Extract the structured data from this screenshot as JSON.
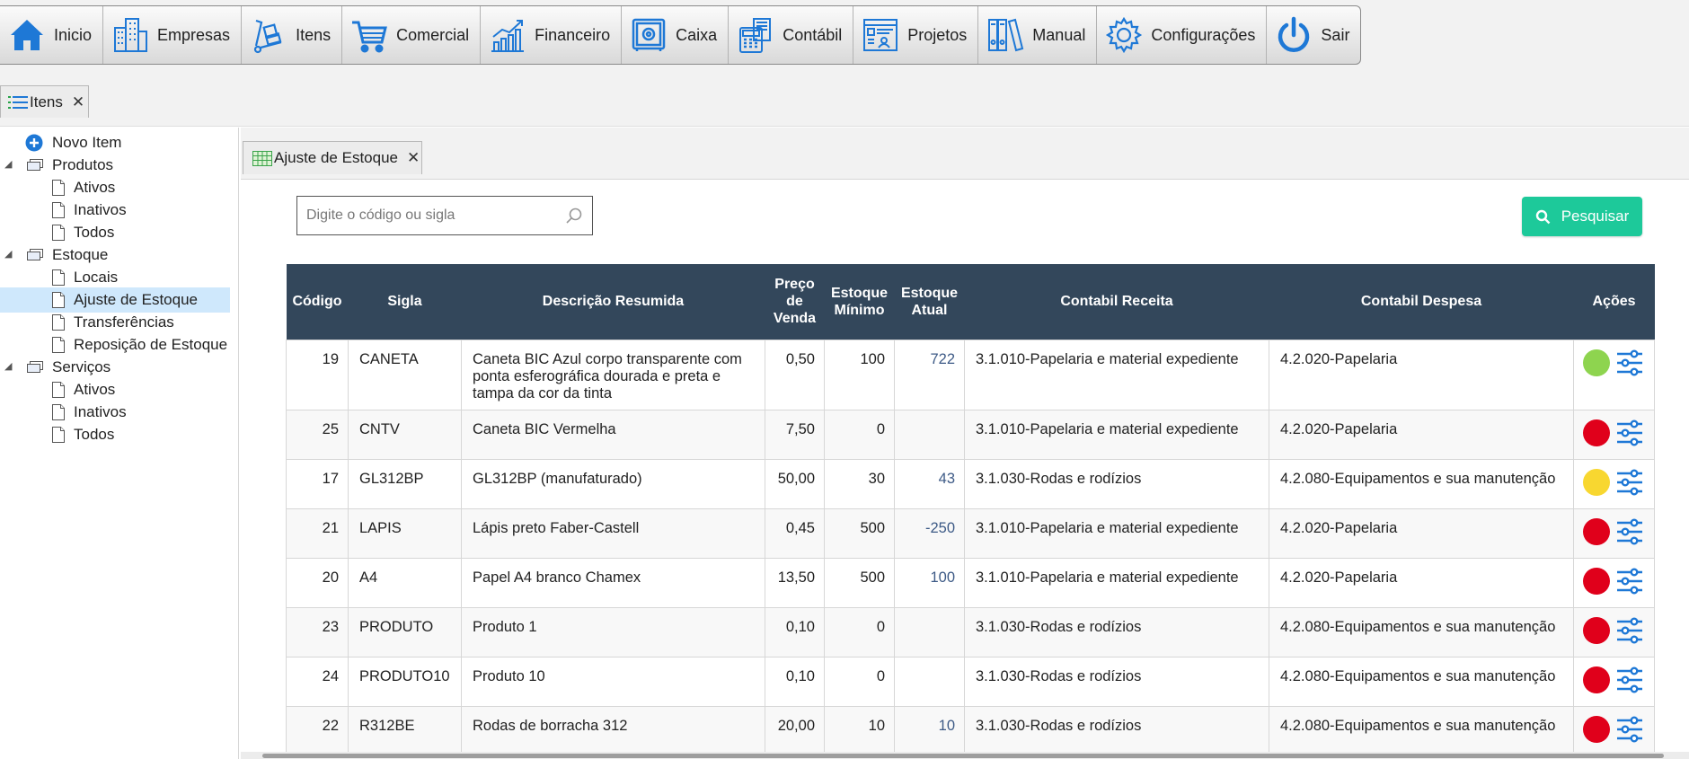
{
  "menu": [
    {
      "label": "Inicio",
      "icon": "home-icon"
    },
    {
      "label": "Empresas",
      "icon": "buildings-icon"
    },
    {
      "label": "Itens",
      "icon": "hand-truck-icon"
    },
    {
      "label": "Comercial",
      "icon": "shopping-cart-icon"
    },
    {
      "label": "Financeiro",
      "icon": "growth-chart-icon"
    },
    {
      "label": "Caixa",
      "icon": "safe-icon"
    },
    {
      "label": "Contábil",
      "icon": "calculator-icon"
    },
    {
      "label": "Projetos",
      "icon": "project-board-icon"
    },
    {
      "label": "Manual",
      "icon": "binders-icon"
    },
    {
      "label": "Configurações",
      "icon": "gear-icon"
    },
    {
      "label": "Sair",
      "icon": "power-icon"
    }
  ],
  "module_tab": {
    "label": "Itens",
    "close": "✕"
  },
  "tree": {
    "new_item": "Novo Item",
    "produtos": {
      "label": "Produtos",
      "children": [
        "Ativos",
        "Inativos",
        "Todos"
      ]
    },
    "estoque": {
      "label": "Estoque",
      "children": [
        "Locais",
        "Ajuste de Estoque",
        "Transferências",
        "Reposição de Estoque"
      ],
      "selected": "Ajuste de Estoque"
    },
    "servicos": {
      "label": "Serviços",
      "children": [
        "Ativos",
        "Inativos",
        "Todos"
      ]
    }
  },
  "sub_tab": {
    "label": "Ajuste de Estoque",
    "close": "✕"
  },
  "search": {
    "placeholder": "Digite o código ou sigla",
    "button": "Pesquisar"
  },
  "table": {
    "headers": [
      "Código",
      "Sigla",
      "Descrição Resumida",
      "Preço de Venda",
      "Estoque Mínimo",
      "Estoque Atual",
      "Contabil Receita",
      "Contabil Despesa",
      "Ações"
    ],
    "rows": [
      {
        "codigo": "19",
        "sigla": "CANETA",
        "descricao": "Caneta BIC Azul corpo transparente com ponta esferográfica dourada e preta e tampa da cor da tinta",
        "preco": "0,50",
        "minimo": "100",
        "atual": "722",
        "receita": "3.1.010-Papelaria e material expediente",
        "despesa": "4.2.020-Papelaria",
        "status": "#8ed44f"
      },
      {
        "codigo": "25",
        "sigla": "CNTV",
        "descricao": "Caneta BIC Vermelha",
        "preco": "7,50",
        "minimo": "0",
        "atual": "",
        "receita": "3.1.010-Papelaria e material expediente",
        "despesa": "4.2.020-Papelaria",
        "status": "#e0001b"
      },
      {
        "codigo": "17",
        "sigla": "GL312BP",
        "descricao": "GL312BP (manufaturado)",
        "preco": "50,00",
        "minimo": "30",
        "atual": "43",
        "receita": "3.1.030-Rodas e rodízios",
        "despesa": "4.2.080-Equipamentos e sua manutenção",
        "status": "#f8d730"
      },
      {
        "codigo": "21",
        "sigla": "LAPIS",
        "descricao": "Lápis preto Faber-Castell",
        "preco": "0,45",
        "minimo": "500",
        "atual": "-250",
        "receita": "3.1.010-Papelaria e material expediente",
        "despesa": "4.2.020-Papelaria",
        "status": "#e0001b"
      },
      {
        "codigo": "20",
        "sigla": "A4",
        "descricao": "Papel A4 branco Chamex",
        "preco": "13,50",
        "minimo": "500",
        "atual": "100",
        "receita": "3.1.010-Papelaria e material expediente",
        "despesa": "4.2.020-Papelaria",
        "status": "#e0001b"
      },
      {
        "codigo": "23",
        "sigla": "PRODUTO",
        "descricao": "Produto 1",
        "preco": "0,10",
        "minimo": "0",
        "atual": "",
        "receita": "3.1.030-Rodas e rodízios",
        "despesa": "4.2.080-Equipamentos e sua manutenção",
        "status": "#e0001b"
      },
      {
        "codigo": "24",
        "sigla": "PRODUTO10",
        "descricao": "Produto 10",
        "preco": "0,10",
        "minimo": "0",
        "atual": "",
        "receita": "3.1.030-Rodas e rodízios",
        "despesa": "4.2.080-Equipamentos e sua manutenção",
        "status": "#e0001b"
      },
      {
        "codigo": "22",
        "sigla": "R312BE",
        "descricao": "Rodas de borracha 312",
        "preco": "20,00",
        "minimo": "10",
        "atual": "10",
        "receita": "3.1.030-Rodas e rodízios",
        "despesa": "4.2.080-Equipamentos e sua manutenção",
        "status": "#e0001b"
      }
    ]
  },
  "colors": {
    "header_bg": "#33475b",
    "accent_button": "#1dc99a",
    "icon_blue": "#1e78d6",
    "selected_row": "#cfe8fc"
  }
}
